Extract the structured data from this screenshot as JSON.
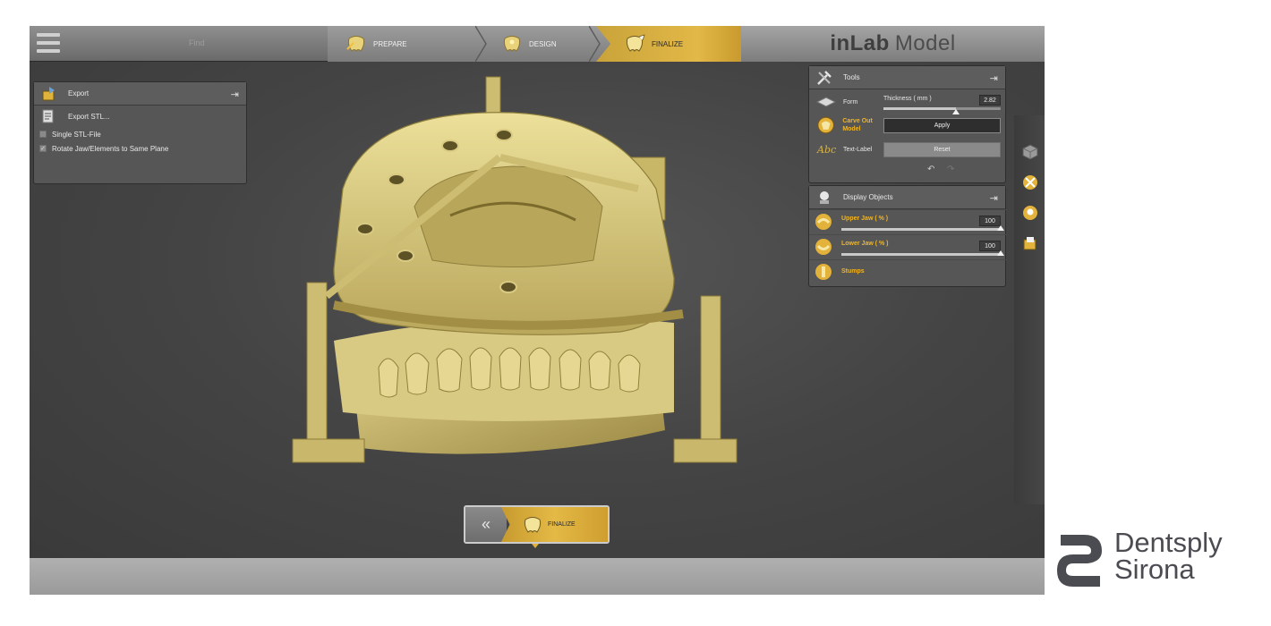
{
  "topbar": {
    "find_label": "Find",
    "steps": [
      {
        "label": "PREPARE",
        "icon": "prepare-tooth-icon",
        "active": false
      },
      {
        "label": "DESIGN",
        "icon": "design-tooth-icon",
        "active": false
      },
      {
        "label": "FINALIZE",
        "icon": "finalize-tooth-icon",
        "active": true
      }
    ],
    "brand_bold": "inLab",
    "brand_light": "Model"
  },
  "export_panel": {
    "title": "Export",
    "icon": "export-icon",
    "export_stl": "Export STL...",
    "options": [
      {
        "label": "Single STL-File",
        "checked": false
      },
      {
        "label": "Rotate Jaw/Elements to Same Plane",
        "checked": true
      }
    ]
  },
  "tools_panel": {
    "title": "Tools",
    "items": [
      {
        "label": "Form",
        "icon": "form-icon"
      },
      {
        "label": "Carve Out Model",
        "icon": "carve-out-icon",
        "active": true
      },
      {
        "label": "Text-Label",
        "icon": "text-label-icon"
      }
    ],
    "thickness_label": "Thickness ( mm )",
    "thickness_value": "2.82",
    "thickness_fraction": 0.62,
    "apply_label": "Apply",
    "reset_label": "Reset",
    "undo_glyph": "↶",
    "redo_glyph": "↷"
  },
  "display_panel": {
    "title": "Display Objects",
    "items": [
      {
        "label": "Upper Jaw ( % )",
        "value": "100",
        "icon": "upper-jaw-icon"
      },
      {
        "label": "Lower Jaw ( % )",
        "value": "100",
        "icon": "lower-jaw-icon"
      },
      {
        "label": "Stumps",
        "icon": "stumps-icon"
      }
    ]
  },
  "bottom_nav": {
    "back_glyph": "«",
    "label": "FINALIZE"
  },
  "logo": {
    "line1": "Dentsply",
    "line2": "Sirona"
  },
  "colors": {
    "accent_gold": "#e2b847",
    "active_text": "#f0b526",
    "model_gold": "#d8c983",
    "background": "#3f3f3f"
  }
}
